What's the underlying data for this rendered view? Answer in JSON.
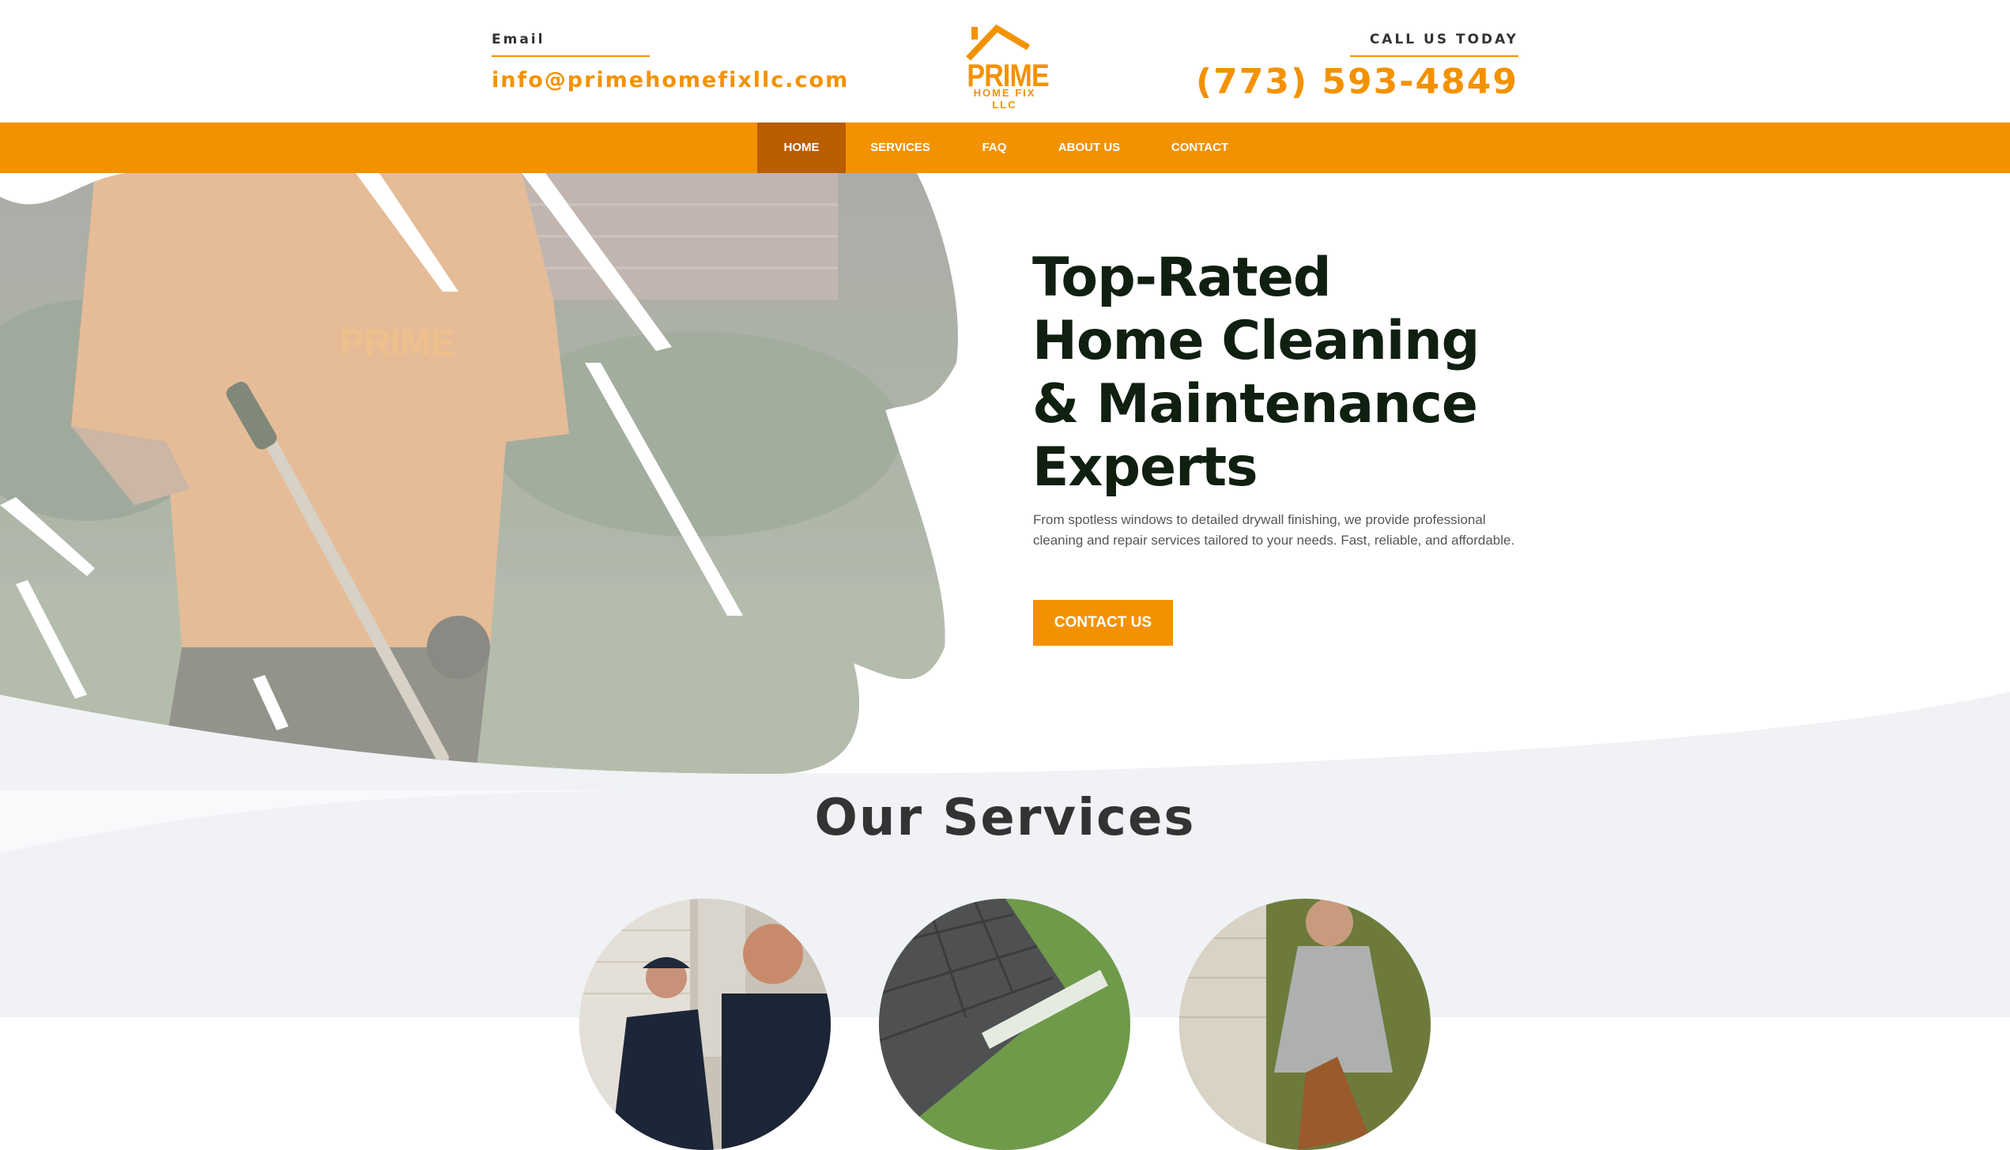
{
  "header": {
    "email_label": "Email",
    "email_value": "info@primehomefixllc.com",
    "phone_label": "CALL US TODAY",
    "phone_value": "(773) 593-4849",
    "logo": {
      "word": "PRIME",
      "subline": "HOME FIX LLC",
      "icon": "house-roof-icon"
    }
  },
  "nav": {
    "items": [
      {
        "label": "HOME",
        "active": true
      },
      {
        "label": "SERVICES",
        "active": false
      },
      {
        "label": "FAQ",
        "active": false
      },
      {
        "label": "ABOUT US",
        "active": false
      },
      {
        "label": "CONTACT",
        "active": false
      }
    ]
  },
  "hero": {
    "title": "Top-Rated Home Cleaning & Maintenance Experts",
    "description": "From spotless windows to detailed drywall finishing, we provide professional cleaning and repair services tailored to your needs. Fast, reliable, and affordable.",
    "cta_label": "CONTACT US",
    "shirt_logo_text": "PRIME"
  },
  "services": {
    "title": "Our Services",
    "items": [
      {
        "image": "workers-photo"
      },
      {
        "image": "roof-gutter-photo"
      },
      {
        "image": "lawn-worker-photo"
      }
    ]
  },
  "colors": {
    "accent": "#f39200",
    "nav_active": "#b85d00",
    "heading_dark": "#0f1f10",
    "services_bg": "#f0f2f5"
  }
}
